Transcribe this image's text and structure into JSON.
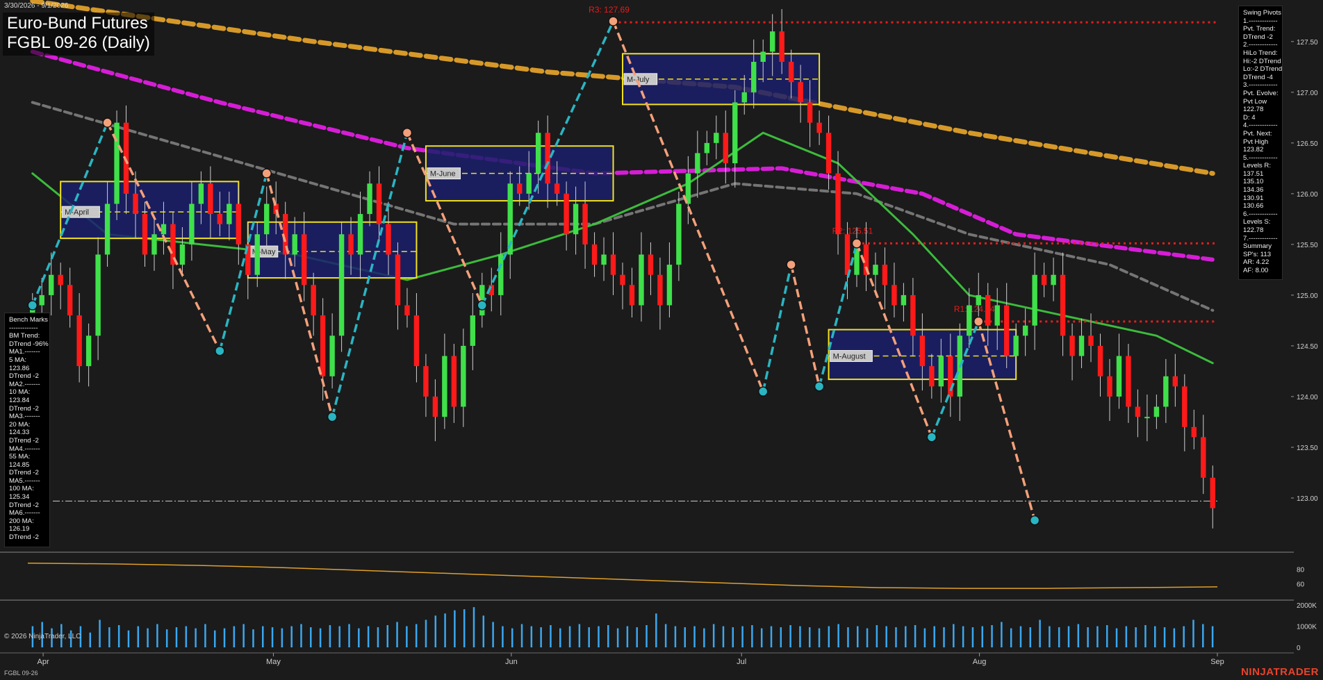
{
  "header": {
    "date_range": "3/30/2026 - 9/1/2026",
    "title": "Euro-Bund Futures",
    "subtitle": "FGBL 09-26 (Daily)"
  },
  "swing_pivots": [
    "Swing Pivots",
    "1.-------------",
    "Pvt. Trend:",
    "DTrend -2",
    "2.-------------",
    "HiLo Trend:",
    "Hi:-2 DTrend",
    "Lo:-2 DTrend",
    "DTrend -4",
    "3.-------------",
    "Pvt. Evolve:",
    "Pvt Low",
    "122.78",
    "D: 4",
    "4.-------------",
    "Pvt. Next:",
    "Pvt High",
    "123.82",
    "5.-------------",
    "Levels R:",
    "137.51",
    "135.10",
    "134.36",
    "130.91",
    "130.66",
    "6.-------------",
    "Levels S:",
    "122.78",
    "7.-------------",
    "Summary",
    "SP's: 113",
    "AR: 4.22",
    "AF: 8.00"
  ],
  "bench_marks": [
    "Bench Marks",
    "-------------",
    "BM Trend:",
    "DTrend -96%",
    "MA1.-------",
    "5 MA:",
    "123.86",
    "DTrend -2",
    "MA2.-------",
    "10 MA:",
    "123.84",
    "DTrend -2",
    "MA3.-------",
    "20 MA:",
    "124.33",
    "DTrend -2",
    "MA4.-------",
    "55 MA:",
    "124.85",
    "DTrend -2",
    "MA5.-------",
    "100 MA:",
    "125.34",
    "DTrend -2",
    "MA6.-------",
    "200 MA:",
    "126.19",
    "DTrend -2"
  ],
  "footer": {
    "copyright": "© 2026 NinjaTrader, LLC",
    "symbol": "FGBL 09-26",
    "brand": "NINJATRADER"
  },
  "colors": {
    "background": "#1b1b1b",
    "up_candle": "#3fe04a",
    "down_candle": "#ff1a1a",
    "swing_down": "#f4a07a",
    "swing_up": "#2ab5c2",
    "ma_orange": "#e0a02a",
    "ma_magenta": "#e01ee0",
    "ma_gray": "#7a7a7a",
    "ma_green": "#3ec43e",
    "box_fill": "#1a1f6b",
    "box_border": "#f2e21a",
    "resistance": "#e81c1c",
    "volume": "#3aa8f0"
  },
  "chart_data": {
    "type": "candlestick",
    "symbol": "FGBL 09-26",
    "timeframe": "Daily",
    "ylim": [
      122.5,
      127.8
    ],
    "y_ticks": [
      "123.00",
      "123.50",
      "124.00",
      "124.50",
      "125.00",
      "125.50",
      "126.00",
      "126.50",
      "127.00",
      "127.50"
    ],
    "x_ticks": [
      {
        "label": "Apr",
        "date": "2026-04-01"
      },
      {
        "label": "May",
        "date": "2026-05-01"
      },
      {
        "label": "Jun",
        "date": "2026-06-01"
      },
      {
        "label": "Jul",
        "date": "2026-07-01"
      },
      {
        "label": "Aug",
        "date": "2026-08-01"
      },
      {
        "label": "Sep",
        "date": "2026-09-01"
      }
    ],
    "date_start": "2026-03-30",
    "date_end": "2026-09-01",
    "close": [
      124.9,
      125.0,
      125.2,
      125.1,
      124.8,
      124.3,
      124.6,
      125.4,
      125.9,
      126.7,
      126.0,
      125.8,
      125.4,
      125.6,
      125.7,
      125.3,
      125.5,
      125.9,
      126.1,
      125.8,
      125.7,
      125.9,
      125.5,
      125.2,
      125.6,
      125.9,
      125.8,
      125.4,
      125.6,
      125.1,
      124.8,
      124.2,
      124.6,
      125.6,
      125.4,
      125.8,
      126.1,
      125.7,
      125.4,
      124.9,
      124.8,
      124.3,
      124.0,
      123.8,
      124.4,
      123.9,
      124.5,
      124.8,
      125.1,
      125.0,
      125.4,
      126.1,
      126.0,
      126.2,
      126.6,
      126.1,
      126.0,
      125.6,
      125.9,
      125.5,
      125.3,
      125.4,
      125.2,
      125.1,
      124.9,
      125.4,
      125.2,
      124.9,
      125.3,
      125.9,
      126.2,
      126.4,
      126.5,
      126.6,
      126.3,
      126.9,
      127.0,
      127.3,
      127.4,
      127.6,
      127.3,
      127.1,
      126.9,
      126.7,
      126.6,
      126.2,
      125.6,
      125.2,
      125.5,
      125.2,
      125.3,
      125.1,
      124.9,
      125.0,
      124.6,
      124.3,
      124.1,
      124.4,
      124.0,
      124.6,
      124.9,
      125.0,
      124.7,
      124.9,
      124.4,
      124.6,
      124.7,
      125.2,
      125.1,
      125.2,
      124.6,
      124.4,
      124.6,
      124.5,
      124.2,
      124.0,
      124.4,
      123.9,
      123.8,
      123.8,
      123.9,
      124.2,
      124.1,
      123.7,
      123.6,
      123.2,
      122.9
    ],
    "moving_averages": [
      {
        "name": "200 MA",
        "color": "#e0a02a",
        "points": [
          [
            0,
            127.9
          ],
          [
            30,
            127.5
          ],
          [
            55,
            127.2
          ],
          [
            75,
            127.05
          ],
          [
            100,
            126.6
          ],
          [
            126,
            126.2
          ]
        ]
      },
      {
        "name": "100 MA",
        "color": "#e01ee0",
        "points": [
          [
            0,
            127.4
          ],
          [
            20,
            126.9
          ],
          [
            40,
            126.45
          ],
          [
            60,
            126.2
          ],
          [
            80,
            126.25
          ],
          [
            95,
            126.0
          ],
          [
            105,
            125.6
          ],
          [
            126,
            125.35
          ]
        ]
      },
      {
        "name": "55 MA",
        "color": "#7a7a7a",
        "points": [
          [
            0,
            126.9
          ],
          [
            15,
            126.5
          ],
          [
            30,
            126.1
          ],
          [
            45,
            125.7
          ],
          [
            60,
            125.7
          ],
          [
            75,
            126.1
          ],
          [
            88,
            126.0
          ],
          [
            100,
            125.6
          ],
          [
            115,
            125.3
          ],
          [
            126,
            124.85
          ]
        ]
      },
      {
        "name": "20 MA",
        "color": "#3ec43e",
        "points": [
          [
            0,
            126.2
          ],
          [
            8,
            125.6
          ],
          [
            18,
            125.5
          ],
          [
            28,
            125.4
          ],
          [
            40,
            125.15
          ],
          [
            50,
            125.4
          ],
          [
            60,
            125.7
          ],
          [
            70,
            126.1
          ],
          [
            78,
            126.6
          ],
          [
            86,
            126.3
          ],
          [
            94,
            125.6
          ],
          [
            100,
            125.0
          ],
          [
            110,
            124.8
          ],
          [
            120,
            124.6
          ],
          [
            126,
            124.33
          ]
        ]
      }
    ],
    "swing_pivots": [
      {
        "x": 0,
        "y": 124.9
      },
      {
        "x": 8,
        "y": 126.7
      },
      {
        "x": 20,
        "y": 124.45
      },
      {
        "x": 25,
        "y": 126.2
      },
      {
        "x": 32,
        "y": 123.8
      },
      {
        "x": 40,
        "y": 126.6
      },
      {
        "x": 48,
        "y": 124.9
      },
      {
        "x": 62,
        "y": 127.7
      },
      {
        "x": 78,
        "y": 124.05
      },
      {
        "x": 81,
        "y": 125.3
      },
      {
        "x": 84,
        "y": 124.1
      },
      {
        "x": 88,
        "y": 125.51
      },
      {
        "x": 96,
        "y": 123.6
      },
      {
        "x": 101,
        "y": 124.74
      },
      {
        "x": 107,
        "y": 122.78
      }
    ],
    "monthly_boxes": [
      {
        "label": "M-April",
        "x0": 3,
        "x1": 22,
        "y0": 125.56,
        "y1": 126.12,
        "mid": 125.82
      },
      {
        "label": "M-May",
        "x0": 23,
        "x1": 41,
        "y0": 125.17,
        "y1": 125.72,
        "mid": 125.43
      },
      {
        "label": "M-June",
        "x0": 42,
        "x1": 62,
        "y0": 125.93,
        "y1": 126.47,
        "mid": 126.2
      },
      {
        "label": "M-July",
        "x0": 63,
        "x1": 84,
        "y0": 126.88,
        "y1": 127.38,
        "mid": 127.13
      },
      {
        "label": "M-August",
        "x0": 85,
        "x1": 105,
        "y0": 124.17,
        "y1": 124.66,
        "mid": 124.4
      }
    ],
    "resistance_levels": [
      {
        "label": "R3: 127.69",
        "value": 127.69
      },
      {
        "label": "R2: 125.51",
        "value": 125.51
      },
      {
        "label": "R1: 124.74",
        "value": 124.74
      }
    ],
    "support_line": 122.97,
    "oscillator": {
      "ticks": [
        "80",
        "60"
      ],
      "ylim": [
        40,
        100
      ],
      "values": [
        88,
        87,
        85,
        82,
        78,
        74,
        70,
        66,
        62,
        58,
        55,
        54,
        54,
        55,
        56
      ]
    },
    "volume": {
      "ticks": [
        "2000K",
        "1000K",
        "0"
      ],
      "ylim": [
        0,
        2100
      ],
      "values": [
        1000,
        1200,
        900,
        1100,
        800,
        1000,
        700,
        1300,
        950,
        1050,
        800,
        1000,
        900,
        1100,
        850,
        950,
        1000,
        900,
        1100,
        800,
        900,
        1000,
        1100,
        850,
        1000,
        950,
        900,
        1000,
        1100,
        950,
        900,
        1050,
        1000,
        1100,
        900,
        1000,
        950,
        1050,
        1200,
        1000,
        1100,
        1300,
        1500,
        1600,
        1750,
        1800,
        1900,
        1500,
        1200,
        1000,
        900,
        1100,
        1000,
        950,
        1050,
        900,
        1000,
        1100,
        950,
        1000,
        1050,
        900,
        1000,
        950,
        1050,
        1600,
        1100,
        1000,
        950,
        1000,
        900,
        1100,
        1000,
        950,
        1000,
        1050,
        900,
        1000,
        950,
        1050,
        1000,
        950,
        900,
        1000,
        1100,
        950,
        1000,
        900,
        1050,
        1000,
        950,
        1000,
        1050,
        900,
        1000,
        950,
        1100,
        1000,
        950,
        1000,
        1050,
        1200,
        900,
        1000,
        950,
        1300,
        1000,
        950,
        1000,
        1100,
        950,
        1000,
        1050,
        900,
        1000,
        950,
        1050,
        1000,
        950,
        900,
        1000,
        1300,
        1100,
        1000
      ]
    }
  }
}
